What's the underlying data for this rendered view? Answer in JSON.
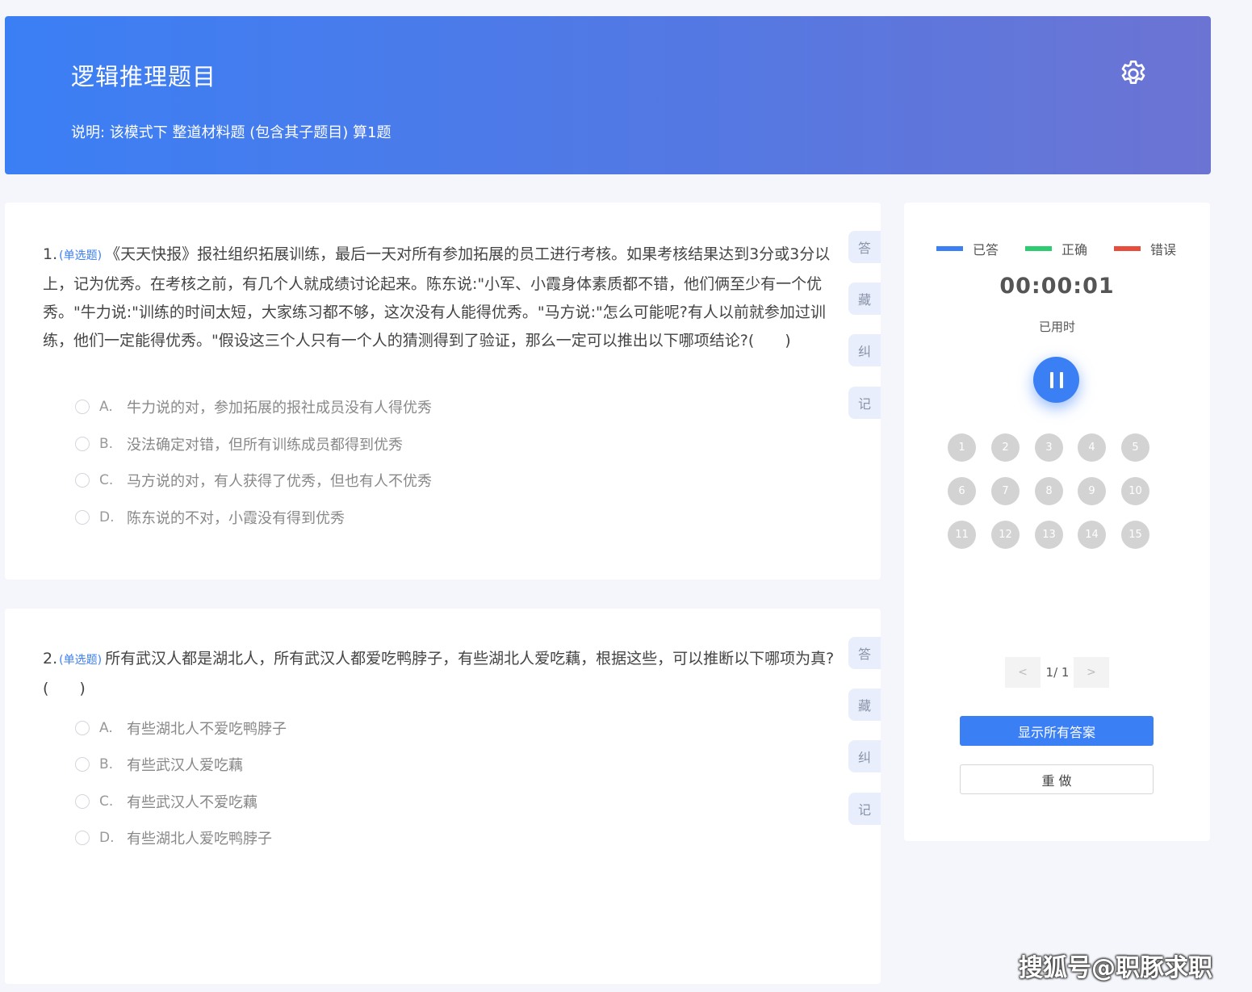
{
  "header": {
    "title": "逻辑推理题目",
    "description": "说明:   该模式下 整道材料题 (包含其子题目) 算1题",
    "settings_icon": "gear-icon"
  },
  "questions": [
    {
      "number": "1.",
      "type": "(单选题)",
      "text": "《天天快报》报社组织拓展训练，最后一天对所有参加拓展的员工进行考核。如果考核结果达到3分或3分以上，记为优秀。在考核之前，有几个人就成绩讨论起来。陈东说:\"小军、小霞身体素质都不错，他们俩至少有一个优秀。\"牛力说:\"训练的时间太短，大家练习都不够，这次没有人能得优秀。\"马方说:\"怎么可能呢?有人以前就参加过训练，他们一定能得优秀。\"假设这三个人只有一个人的猜测得到了验证，那么一定可以推出以下哪项结论?(　　)",
      "options": [
        {
          "letter": "A.",
          "text": "牛力说的对，参加拓展的报社成员没有人得优秀"
        },
        {
          "letter": "B.",
          "text": "没法确定对错，但所有训练成员都得到优秀"
        },
        {
          "letter": "C.",
          "text": "马方说的对，有人获得了优秀，但也有人不优秀"
        },
        {
          "letter": "D.",
          "text": "陈东说的不对，小霞没有得到优秀"
        }
      ]
    },
    {
      "number": "2.",
      "type": "(单选题)",
      "text": "所有武汉人都是湖北人，所有武汉人都爱吃鸭脖子，有些湖北人爱吃藕，根据这些，可以推断以下哪项为真?(　　)",
      "options": [
        {
          "letter": "A.",
          "text": "有些湖北人不爱吃鸭脖子"
        },
        {
          "letter": "B.",
          "text": "有些武汉人爱吃藕"
        },
        {
          "letter": "C.",
          "text": "有些武汉人不爱吃藕"
        },
        {
          "letter": "D.",
          "text": "有些湖北人爱吃鸭脖子"
        }
      ]
    }
  ],
  "side_tabs": [
    "答",
    "藏",
    "纠",
    "记"
  ],
  "panel": {
    "legend": [
      {
        "label": "已答",
        "color": "#3b7ff5"
      },
      {
        "label": "正确",
        "color": "#2ecc71"
      },
      {
        "label": "错误",
        "color": "#e74c3c"
      }
    ],
    "timer": "00:00:01",
    "timer_label": "已用时",
    "pause_icon": "pause-icon",
    "question_numbers": [
      "1",
      "2",
      "3",
      "4",
      "5",
      "6",
      "7",
      "8",
      "9",
      "10",
      "11",
      "12",
      "13",
      "14",
      "15"
    ],
    "pager": {
      "prev": "<",
      "text": "1/ 1",
      "next": ">"
    },
    "show_answers_label": "显示所有答案",
    "redo_label": "重 做"
  },
  "watermark": "搜狐号@职豚求职"
}
